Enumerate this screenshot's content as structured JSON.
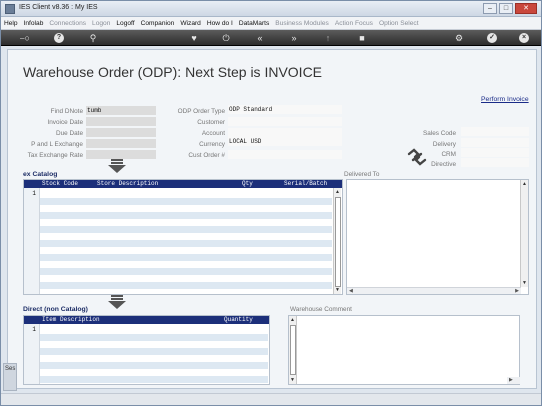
{
  "window": {
    "title": "IES Client v8.36 : My IES"
  },
  "menu": {
    "items": [
      {
        "label": "Help",
        "enabled": true
      },
      {
        "label": "Infolab",
        "enabled": true
      },
      {
        "label": "Connections",
        "enabled": false
      },
      {
        "label": "Logon",
        "enabled": false
      },
      {
        "label": "Logoff",
        "enabled": true
      },
      {
        "label": "Companion",
        "enabled": true
      },
      {
        "label": "Wizard",
        "enabled": true
      },
      {
        "label": "How do I",
        "enabled": true
      },
      {
        "label": "DataMarts",
        "enabled": true
      },
      {
        "label": "Business Modules",
        "enabled": false
      },
      {
        "label": "Action Focus",
        "enabled": false
      },
      {
        "label": "Option Select",
        "enabled": false
      }
    ]
  },
  "toolbar": {
    "icons": [
      "key-icon",
      "help-icon",
      "search-icon",
      "heart-icon",
      "power-icon",
      "rewind-icon",
      "forward-icon",
      "exit-icon",
      "stop-icon",
      "settings-icon",
      "check-icon",
      "close-icon"
    ]
  },
  "page": {
    "title": "Warehouse Order (ODP): Next Step is INVOICE",
    "perform_link": "Perform Invoice"
  },
  "form": {
    "find_dnote": {
      "label": "Find DNote",
      "value": "tumb"
    },
    "invoice_date": {
      "label": "Invoice Date",
      "value": ""
    },
    "due_date": {
      "label": "Due Date",
      "value": ""
    },
    "p_and_l_exchange": {
      "label": "P and L Exchange",
      "value": ""
    },
    "tax_exchange_rate": {
      "label": "Tax Exchange Rate",
      "value": ""
    },
    "odp_order_type": {
      "label": "ODP Order Type",
      "value": "ODP Standard"
    },
    "customer": {
      "label": "Customer",
      "value": ""
    },
    "account": {
      "label": "Account",
      "value": ""
    },
    "currency": {
      "label": "Currency",
      "value": "LOCAL USD"
    },
    "cust_order": {
      "label": "Cust Order #",
      "value": ""
    },
    "sales_code": {
      "label": "Sales Code",
      "value": ""
    },
    "delivery": {
      "label": "Delivery",
      "value": ""
    },
    "crm": {
      "label": "CRM",
      "value": ""
    },
    "directive": {
      "label": "Directive",
      "value": ""
    }
  },
  "ex_catalog": {
    "title": "ex Catalog",
    "columns": [
      "Stock Code",
      "Store Description",
      "Qty",
      "Serial/Batch"
    ],
    "row_numbers": [
      "1"
    ]
  },
  "delivered_to": {
    "label": "Delivered To",
    "value": ""
  },
  "direct": {
    "title": "Direct (non Catalog)",
    "columns": [
      "Item Description",
      "Quantity"
    ],
    "row_numbers": [
      "1"
    ]
  },
  "warehouse_comment": {
    "label": "Warehouse  Comment",
    "value": ""
  },
  "side_stub": {
    "text": "Ses"
  }
}
